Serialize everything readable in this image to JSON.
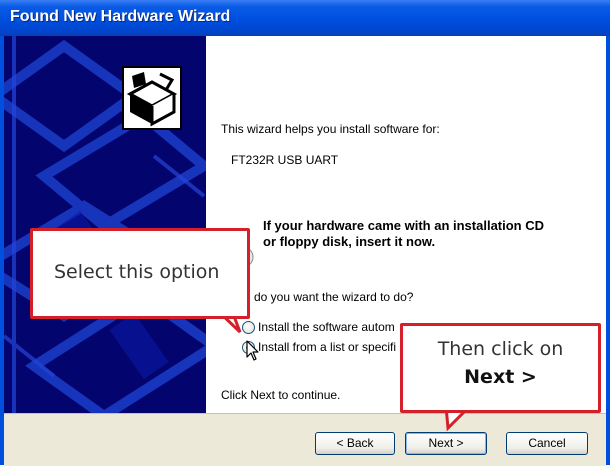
{
  "window": {
    "title": "Found New Hardware Wizard"
  },
  "main": {
    "intro": "This wizard helps you install software for:",
    "device_name": "FT232R USB UART",
    "cd_prompt_line1": "If your hardware came with an installation CD",
    "cd_prompt_line2": "or floppy disk, insert it now.",
    "question": "do you want the wizard to do?",
    "options": [
      {
        "label": "Install the software autom",
        "selected": false
      },
      {
        "label": "Install from a list or specifi",
        "selected": true
      }
    ],
    "continue_text": "Click Next to continue."
  },
  "buttons": {
    "back": "< Back",
    "next": "Next >",
    "cancel": "Cancel"
  },
  "annotations": {
    "callout1": "Select this option",
    "callout2_line1": "Then click on",
    "callout2_line2": "Next >"
  },
  "colors": {
    "title_bar": "#0050e0",
    "sidebar": "#04046e",
    "callout_border": "#d42028"
  },
  "icons": [
    "hardware-box-icon",
    "cd-icon",
    "mouse-cursor-icon"
  ]
}
